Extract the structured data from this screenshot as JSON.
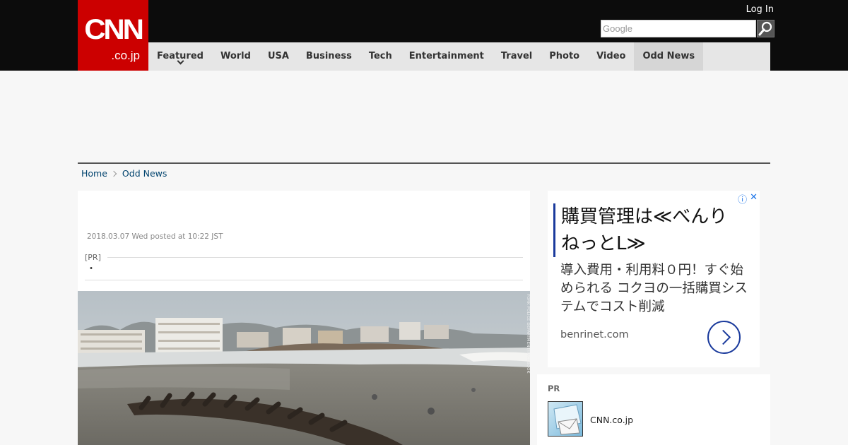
{
  "header": {
    "logo_main": "CNN",
    "logo_sub": ".co.jp",
    "login_label": "Log In",
    "search_placeholder": "Google"
  },
  "nav": {
    "items": [
      "Featured",
      "World",
      "USA",
      "Business",
      "Tech",
      "Entertainment",
      "Travel",
      "Photo",
      "Video",
      "Odd News"
    ],
    "active": "Odd News"
  },
  "breadcrumb": [
    "Home",
    "Odd News"
  ],
  "article": {
    "dateline": "2018.03.07 Wed posted at 10:22 JST",
    "pr_label": "[PR]",
    "pr_text": "・",
    "photo_credit": "YORK POLICE DEPARTMENT/FACEBOOK"
  },
  "ad": {
    "headline": "購買管理は≪べんりねっとL≫",
    "body": "導入費用・利用料０円！すぐ始められる コクヨの一括購買システムでコスト削減",
    "domain": "benrinet.com"
  },
  "pr_box": {
    "title": "PR",
    "item_name": "CNN.co.jp"
  },
  "colors": {
    "brand_red": "#cc0000",
    "header_black": "#0c0c0c",
    "link_blue": "#00436e",
    "ad_accent": "#1a3a9c"
  }
}
